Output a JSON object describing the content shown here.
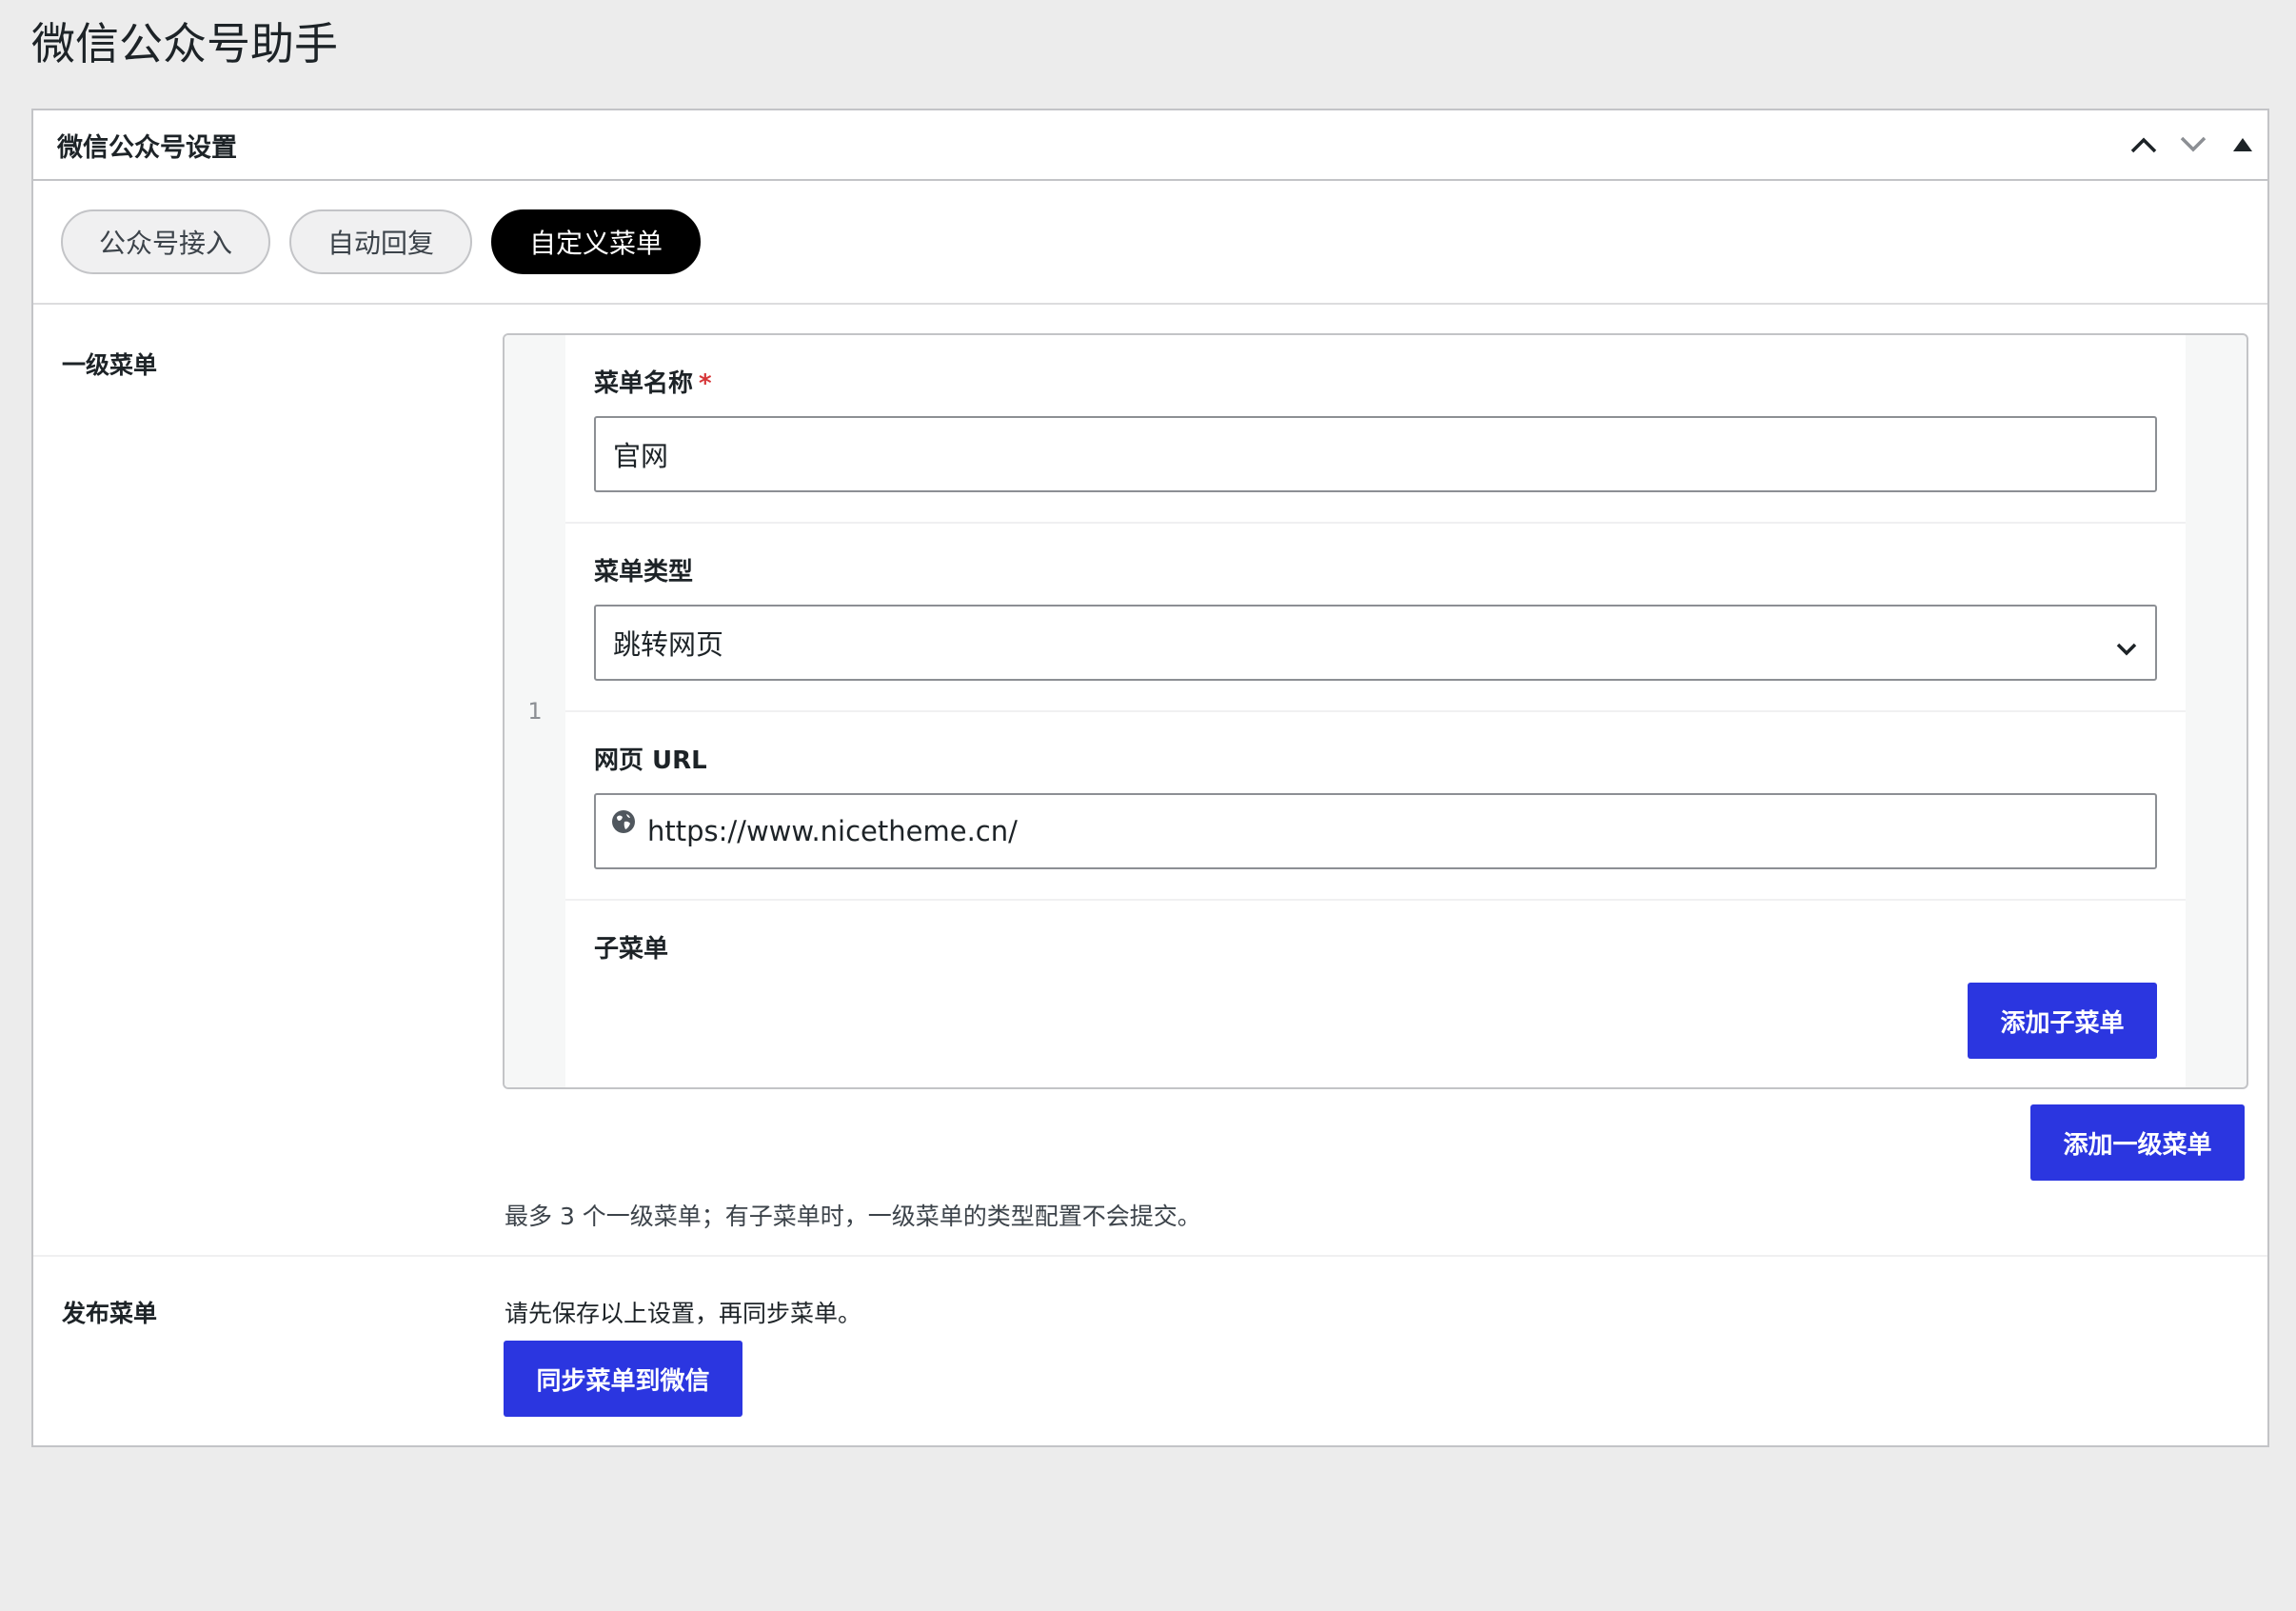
{
  "page": {
    "title": "微信公众号助手"
  },
  "panel": {
    "title": "微信公众号设置",
    "controls": [
      "chevron-up-icon",
      "chevron-down-icon",
      "triangle-up-icon"
    ]
  },
  "tabs": [
    {
      "label": "公众号接入",
      "active": false
    },
    {
      "label": "自动回复",
      "active": false
    },
    {
      "label": "自定义菜单",
      "active": true
    }
  ],
  "primary_menu": {
    "label": "一级菜单",
    "items": [
      {
        "index": "1",
        "name_label": "菜单名称",
        "required_mark": "*",
        "name_value": "官网",
        "type_label": "菜单类型",
        "type_value": "跳转网页",
        "url_label": "网页 URL",
        "url_value": "https://www.nicetheme.cn/",
        "submenu_label": "子菜单",
        "add_submenu_button": "添加子菜单"
      }
    ],
    "add_primary_button": "添加一级菜单",
    "note": "最多 3 个一级菜单；有子菜单时，一级菜单的类型配置不会提交。"
  },
  "publish": {
    "label": "发布菜单",
    "note": "请先保存以上设置，再同步菜单。",
    "sync_button": "同步菜单到微信"
  },
  "colors": {
    "accent": "#2b36e0",
    "active_tab": "#000000",
    "required": "#d63638",
    "background": "#ececec"
  }
}
